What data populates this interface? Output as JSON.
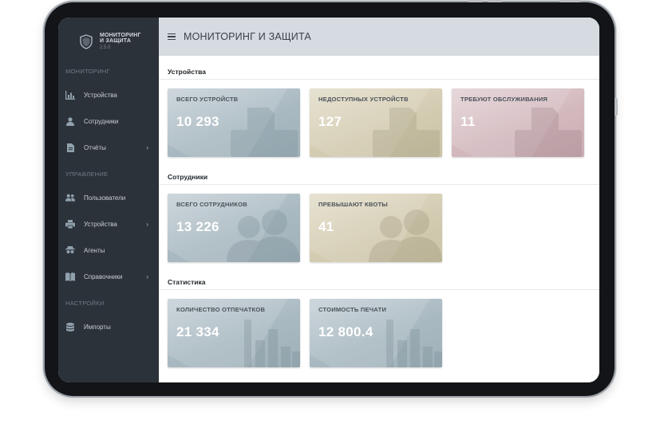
{
  "app": {
    "logo_line1": "МОНИТОРИНГ",
    "logo_line2": "И ЗАЩИТА",
    "version": "2.5.0"
  },
  "sidebar": {
    "sections": [
      {
        "label": "МОНИТОРИНГ",
        "items": [
          {
            "label": "Устройства",
            "icon": "bar-chart-icon",
            "has_submenu": false
          },
          {
            "label": "Сотрудники",
            "icon": "person-icon",
            "has_submenu": false
          },
          {
            "label": "Отчёты",
            "icon": "document-icon",
            "has_submenu": true
          }
        ]
      },
      {
        "label": "УПРАВЛЕНИЕ",
        "items": [
          {
            "label": "Пользователи",
            "icon": "users-icon",
            "has_submenu": false
          },
          {
            "label": "Устройства",
            "icon": "printer-icon",
            "has_submenu": true
          },
          {
            "label": "Агенты",
            "icon": "agent-icon",
            "has_submenu": false
          },
          {
            "label": "Справочники",
            "icon": "book-icon",
            "has_submenu": true
          }
        ]
      },
      {
        "label": "НАСТРОЙКИ",
        "items": [
          {
            "label": "Импорты",
            "icon": "database-icon",
            "has_submenu": false
          }
        ]
      }
    ],
    "chevron": "›"
  },
  "header": {
    "title": "МОНИТОРИНГ И ЗАЩИТА"
  },
  "dashboard": {
    "devices": {
      "title": "Устройства",
      "tiles": [
        {
          "label": "ВСЕГО УСТРОЙСТВ",
          "value": "10 293",
          "color": "#a9b9c1"
        },
        {
          "label": "НЕДОСТУПНЫХ УСТРОЙСТВ",
          "value": "127",
          "color": "#d4ccb2"
        },
        {
          "label": "ТРЕБУЮТ ОБСЛУЖИВАНИЯ",
          "value": "11",
          "color": "#d3b9be"
        }
      ]
    },
    "employees": {
      "title": "Сотрудники",
      "tiles": [
        {
          "label": "ВСЕГО СОТРУДНИКОВ",
          "value": "13 226",
          "color": "#a9b9c1"
        },
        {
          "label": "ПРЕВЫШАЮТ КВОТЫ",
          "value": "41",
          "color": "#d4ccb2"
        }
      ]
    },
    "statistics": {
      "title": "Статистика",
      "tiles": [
        {
          "label": "КОЛИЧЕСТВО ОТПЕЧАТКОВ",
          "value": "21 334",
          "color": "#a9b9c1"
        },
        {
          "label": "СТОИМОСТЬ ПЕЧАТИ",
          "value": "12 800.4",
          "color": "#a9b9c1"
        }
      ]
    }
  }
}
